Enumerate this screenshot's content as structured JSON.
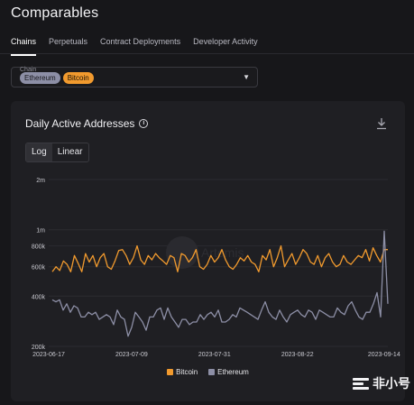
{
  "page": {
    "title": "Comparables"
  },
  "tabs": [
    {
      "label": "Chains",
      "active": true
    },
    {
      "label": "Perpetuals",
      "active": false
    },
    {
      "label": "Contract Deployments",
      "active": false
    },
    {
      "label": "Developer Activity",
      "active": false
    }
  ],
  "filter": {
    "label": "Chain",
    "chips": [
      {
        "label": "Ethereum",
        "color": "#8d8fa6"
      },
      {
        "label": "Bitcoin",
        "color": "#f19a2e"
      }
    ]
  },
  "panel": {
    "title": "Daily Active Addresses",
    "scale_options": [
      "Log",
      "Linear"
    ],
    "selected_scale": "Log",
    "watermark": "Artemis"
  },
  "chart_data": {
    "type": "line",
    "title": "Daily Active Addresses",
    "y_scale": "log",
    "ylim": [
      200000,
      2000000
    ],
    "y_ticks": [
      {
        "value": 2000000,
        "label": "2m"
      },
      {
        "value": 1000000,
        "label": "1m"
      },
      {
        "value": 800000,
        "label": "800k"
      },
      {
        "value": 600000,
        "label": "600k"
      },
      {
        "value": 400000,
        "label": "400k"
      },
      {
        "value": 200000,
        "label": "200k"
      }
    ],
    "x_tick_labels": [
      "2023-06-17",
      "2023-07-09",
      "2023-07-31",
      "2023-08-22",
      "2023-09-14"
    ],
    "x_start": "2023-06-17",
    "x_end": "2023-09-15",
    "grid": true,
    "legend_position": "bottom",
    "series": [
      {
        "name": "Bitcoin",
        "color": "#f19a2e",
        "values": [
          560000,
          600000,
          570000,
          650000,
          620000,
          560000,
          700000,
          630000,
          560000,
          720000,
          640000,
          700000,
          600000,
          680000,
          720000,
          600000,
          580000,
          650000,
          750000,
          760000,
          700000,
          620000,
          680000,
          800000,
          660000,
          620000,
          700000,
          660000,
          720000,
          680000,
          650000,
          620000,
          700000,
          680000,
          560000,
          720000,
          700000,
          640000,
          680000,
          760000,
          600000,
          580000,
          620000,
          700000,
          640000,
          680000,
          760000,
          660000,
          600000,
          580000,
          620000,
          680000,
          650000,
          700000,
          640000,
          620000,
          560000,
          700000,
          660000,
          760000,
          600000,
          680000,
          800000,
          600000,
          660000,
          720000,
          620000,
          680000,
          760000,
          720000,
          640000,
          620000,
          700000,
          600000,
          680000,
          720000,
          640000,
          600000,
          620000,
          700000,
          640000,
          620000,
          660000,
          700000,
          680000,
          760000,
          650000,
          780000,
          700000,
          640000,
          760000,
          760000
        ]
      },
      {
        "name": "Ethereum",
        "color": "#8d8fa6",
        "values": [
          380000,
          370000,
          380000,
          330000,
          360000,
          320000,
          350000,
          340000,
          300000,
          300000,
          320000,
          310000,
          320000,
          290000,
          300000,
          310000,
          300000,
          270000,
          330000,
          300000,
          290000,
          230000,
          260000,
          320000,
          300000,
          280000,
          250000,
          300000,
          300000,
          330000,
          340000,
          290000,
          340000,
          300000,
          280000,
          260000,
          290000,
          290000,
          270000,
          280000,
          280000,
          310000,
          290000,
          310000,
          320000,
          300000,
          330000,
          280000,
          280000,
          290000,
          310000,
          300000,
          340000,
          330000,
          320000,
          310000,
          300000,
          290000,
          330000,
          370000,
          320000,
          300000,
          290000,
          330000,
          300000,
          280000,
          310000,
          320000,
          330000,
          310000,
          300000,
          330000,
          320000,
          290000,
          330000,
          320000,
          310000,
          300000,
          300000,
          340000,
          320000,
          310000,
          350000,
          370000,
          330000,
          300000,
          290000,
          320000,
          320000,
          360000,
          420000,
          300000,
          980000,
          360000
        ]
      }
    ]
  }
}
